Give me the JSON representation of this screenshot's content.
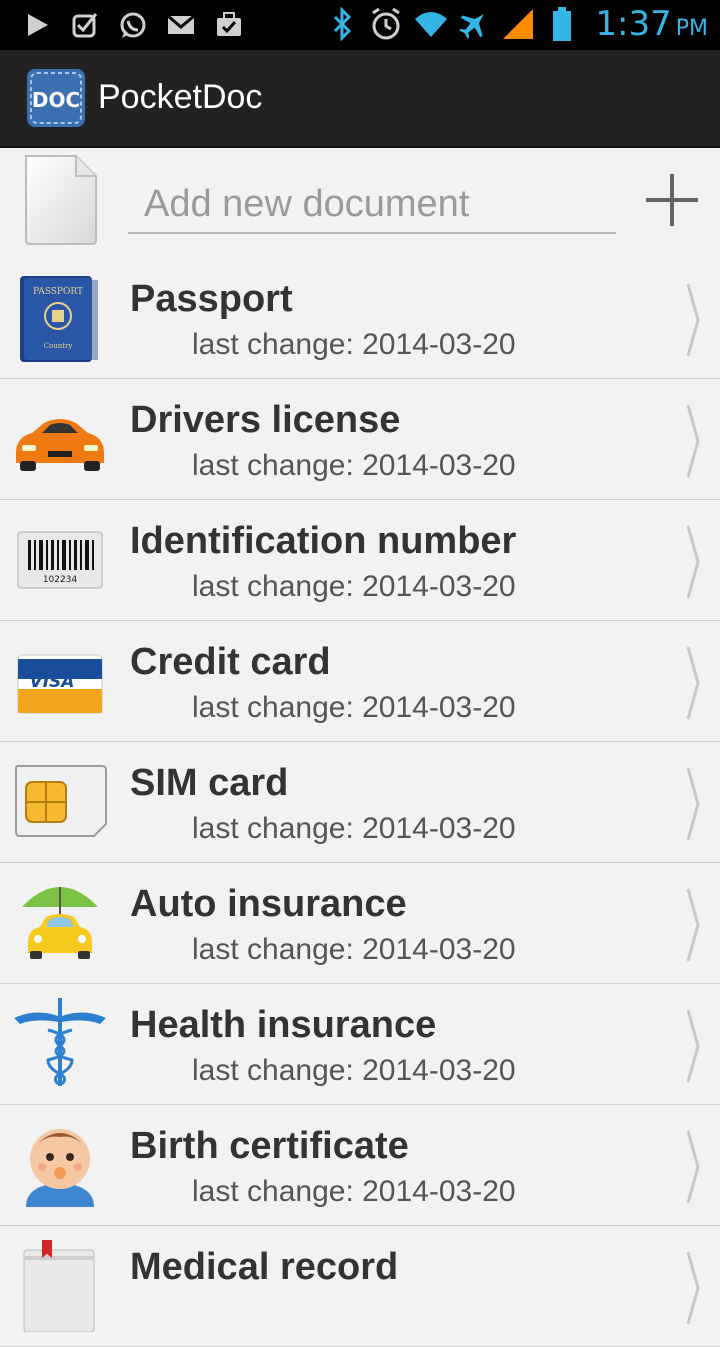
{
  "status_bar": {
    "time": "1:37",
    "ampm": "PM",
    "icons": [
      "play-icon",
      "checkbox-icon",
      "whatsapp-icon",
      "gmail-icon",
      "briefcase-check-icon",
      "bluetooth-icon",
      "alarm-icon",
      "wifi-icon",
      "airplane-icon",
      "signal-icon",
      "battery-icon"
    ]
  },
  "app": {
    "title": "PocketDoc",
    "logo_text": "DOC"
  },
  "add_row": {
    "placeholder": "Add new document",
    "value": ""
  },
  "documents": [
    {
      "title": "Passport",
      "subtitle": "last change: 2014-03-20",
      "icon": "passport-icon"
    },
    {
      "title": "Drivers license",
      "subtitle": "last change: 2014-03-20",
      "icon": "car-icon"
    },
    {
      "title": "Identification number",
      "subtitle": "last change: 2014-03-20",
      "icon": "barcode-icon"
    },
    {
      "title": "Credit card",
      "subtitle": "last change: 2014-03-20",
      "icon": "credit-card-icon"
    },
    {
      "title": "SIM card",
      "subtitle": "last change: 2014-03-20",
      "icon": "sim-card-icon"
    },
    {
      "title": "Auto insurance",
      "subtitle": "last change: 2014-03-20",
      "icon": "car-umbrella-icon"
    },
    {
      "title": "Health insurance",
      "subtitle": "last change: 2014-03-20",
      "icon": "caduceus-icon"
    },
    {
      "title": "Birth certificate",
      "subtitle": "last change: 2014-03-20",
      "icon": "baby-icon"
    },
    {
      "title": "Medical record",
      "subtitle": "",
      "icon": "medical-book-icon"
    }
  ],
  "colors": {
    "time": "#33b5e5",
    "actionbar": "#222222",
    "background": "#f2f2f2"
  }
}
